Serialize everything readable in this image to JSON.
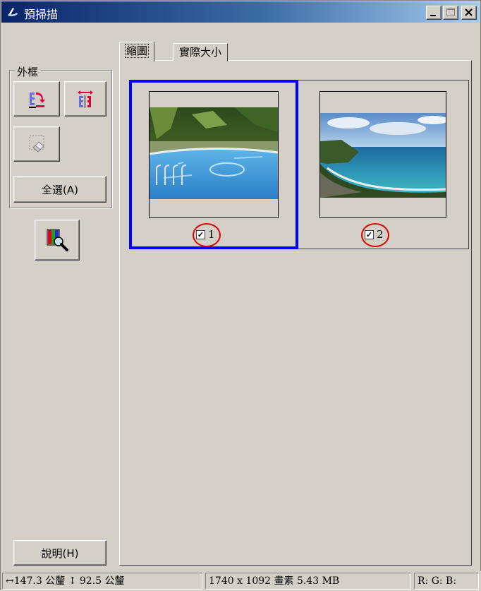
{
  "window": {
    "title": "預掃描",
    "minimize_symbol": "_",
    "maximize_symbol": "□",
    "close_symbol": "×"
  },
  "frame_group": {
    "label": "外框",
    "auto_locate_icon": "auto-locate-frame-icon",
    "adjust_frame_icon": "adjust-frame-size-icon",
    "erase_frame_icon": "erase-frame-icon",
    "select_all_label": "全選(A)"
  },
  "zoom_icon": "zoom-magnifier-icon",
  "help_label": "說明(H)",
  "tabs": [
    {
      "label": "縮圖",
      "active": true
    },
    {
      "label": "實際大小",
      "active": false
    }
  ],
  "thumbnails": [
    {
      "number": "1",
      "checked": true,
      "selected": true,
      "scene": "swimming pool"
    },
    {
      "number": "2",
      "checked": true,
      "selected": false,
      "scene": "coastline"
    }
  ],
  "status": {
    "dimensions": "147.3 公釐 ↕ 92.5 公釐",
    "size_info": "1740 x 1092 畫素 5.43 MB",
    "rgb": "R: G: B:"
  },
  "colors": {
    "selection": "#0000ff",
    "highlight_ring": "#e00000",
    "face": "#d4d0c8"
  }
}
